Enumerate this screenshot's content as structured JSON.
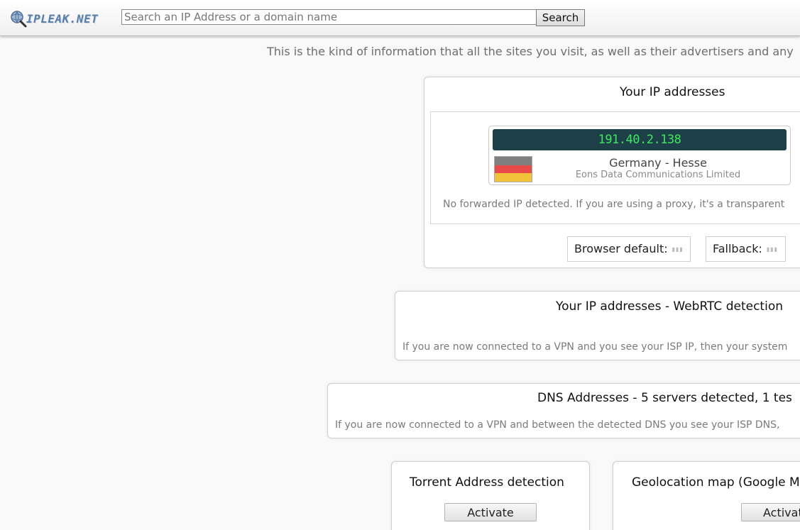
{
  "header": {
    "logo_text": "IPLEAK.NET",
    "search_placeholder": "Search an IP Address or a domain name",
    "search_value": "",
    "search_button": "Search"
  },
  "intro_text": "This is the kind of information that all the sites you visit, as well as their advertisers and any",
  "ip_panel": {
    "title": "Your IP addresses",
    "ip": "191.40.2.138",
    "country": "Germany - Hesse",
    "isp": "Eons Data Communications Limited",
    "forwarded_note": "No forwarded IP detected. If you are using a proxy, it's a transparent",
    "browser_default_label": "Browser default:",
    "fallback_label": "Fallback:",
    "flag_colors": [
      "#7f7f7f",
      "#e84a4a",
      "#f2c23a"
    ]
  },
  "webrtc_panel": {
    "title": "Your IP addresses - WebRTC detection",
    "note": "If you are now connected to a VPN and you see your ISP IP, then your system"
  },
  "dns_panel": {
    "title": "DNS Addresses - 5 servers detected, 1 tes",
    "note": "If you are now connected to a VPN and between the detected DNS you see your ISP DNS,"
  },
  "torrent_panel": {
    "title": "Torrent Address detection",
    "button": "Activate"
  },
  "geo_panel": {
    "title": "Geolocation map (Google M",
    "button": "Activat"
  },
  "colors": {
    "ip_bar_bg": "#1d3f48",
    "ip_text": "#3ee85e",
    "logo": "#5a7fa8"
  }
}
